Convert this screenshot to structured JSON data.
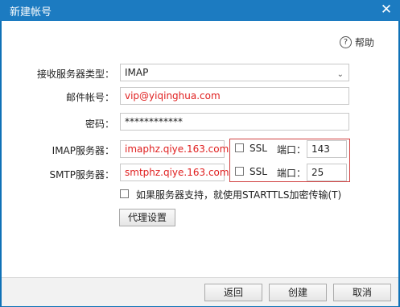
{
  "window": {
    "title": "新建帐号",
    "close_glyph": "✕"
  },
  "help": {
    "label": "帮助",
    "icon": "?"
  },
  "form": {
    "protocol": {
      "label": "接收服务器类型：",
      "value": "IMAP"
    },
    "account": {
      "label": "邮件帐号：",
      "value": "vip@yiqinghua.com"
    },
    "password": {
      "label": "密码：",
      "value": "************"
    },
    "imap": {
      "label": "IMAP服务器：",
      "value": "imaphz.qiye.163.com",
      "ssl_label": "SSL",
      "port_label": "端口：",
      "port": "143"
    },
    "smtp": {
      "label": "SMTP服务器：",
      "value": "smtphz.qiye.163.com",
      "ssl_label": "SSL",
      "port_label": "端口：",
      "port": "25"
    },
    "starttls": {
      "label": "如果服务器支持，就使用STARTTLS加密传输(T)"
    },
    "proxy_button": "代理设置"
  },
  "footer": {
    "back": "返回",
    "create": "创建",
    "cancel": "取消"
  }
}
